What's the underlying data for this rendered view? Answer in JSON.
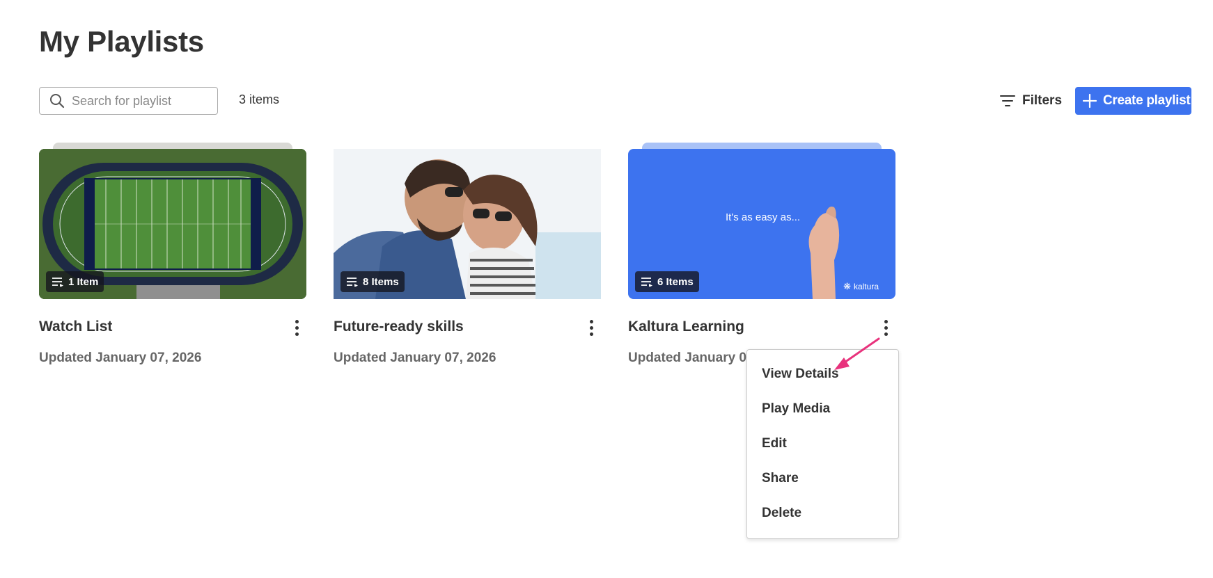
{
  "page": {
    "title": "My Playlists"
  },
  "toolbar": {
    "search_placeholder": "Search for playlist",
    "item_count": "3 items",
    "filters_label": "Filters",
    "create_label": "Create playlist"
  },
  "cards": [
    {
      "title": "Watch List",
      "updated": "Updated January 07, 2026",
      "badge": "1 Item"
    },
    {
      "title": "Future-ready skills",
      "updated": "Updated January 07, 2026",
      "badge": "8 Items"
    },
    {
      "title": "Kaltura Learning",
      "updated": "Updated January 07, 2026",
      "badge": "6 Items",
      "thumb_caption": "It's as easy as...",
      "thumb_logo": "kaltura"
    }
  ],
  "menu": {
    "items": [
      "View Details",
      "Play Media",
      "Edit",
      "Share",
      "Delete"
    ]
  },
  "colors": {
    "accent": "#3d73ef",
    "annotation_arrow": "#e8327c",
    "text": "#333333"
  },
  "icons": {
    "search": "search-icon",
    "filters": "filter-lines-icon",
    "create": "plus-icon",
    "playlist": "playlist-icon",
    "kebab": "more-vertical-icon"
  }
}
